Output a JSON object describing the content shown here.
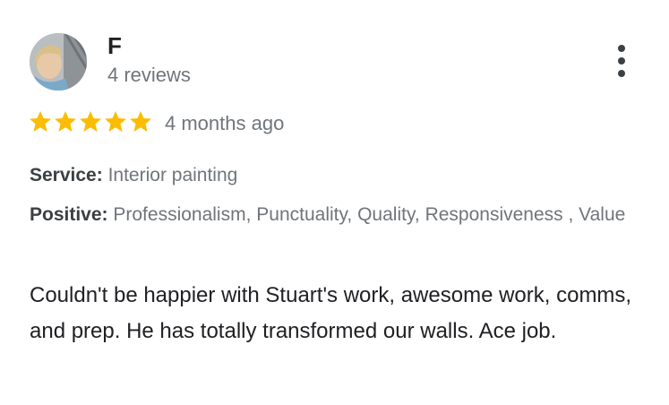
{
  "reviewer": {
    "name": "F",
    "review_count": "4 reviews",
    "avatar_icon": "profile-photo"
  },
  "more_icon": "more-vertical-icon",
  "rating": {
    "stars": 5,
    "out_of": 5,
    "color": "#fbbc04"
  },
  "time_ago": "4 months ago",
  "attributes": {
    "service_label": "Service:",
    "service_value": "Interior painting",
    "positive_label": "Positive:",
    "positive_value": "Professionalism, Punctuality, Quality, Responsiveness , Value"
  },
  "review_text": "Couldn't be happier with Stuart's work, awesome work, comms, and prep. He has totally transformed our walls. Ace job."
}
